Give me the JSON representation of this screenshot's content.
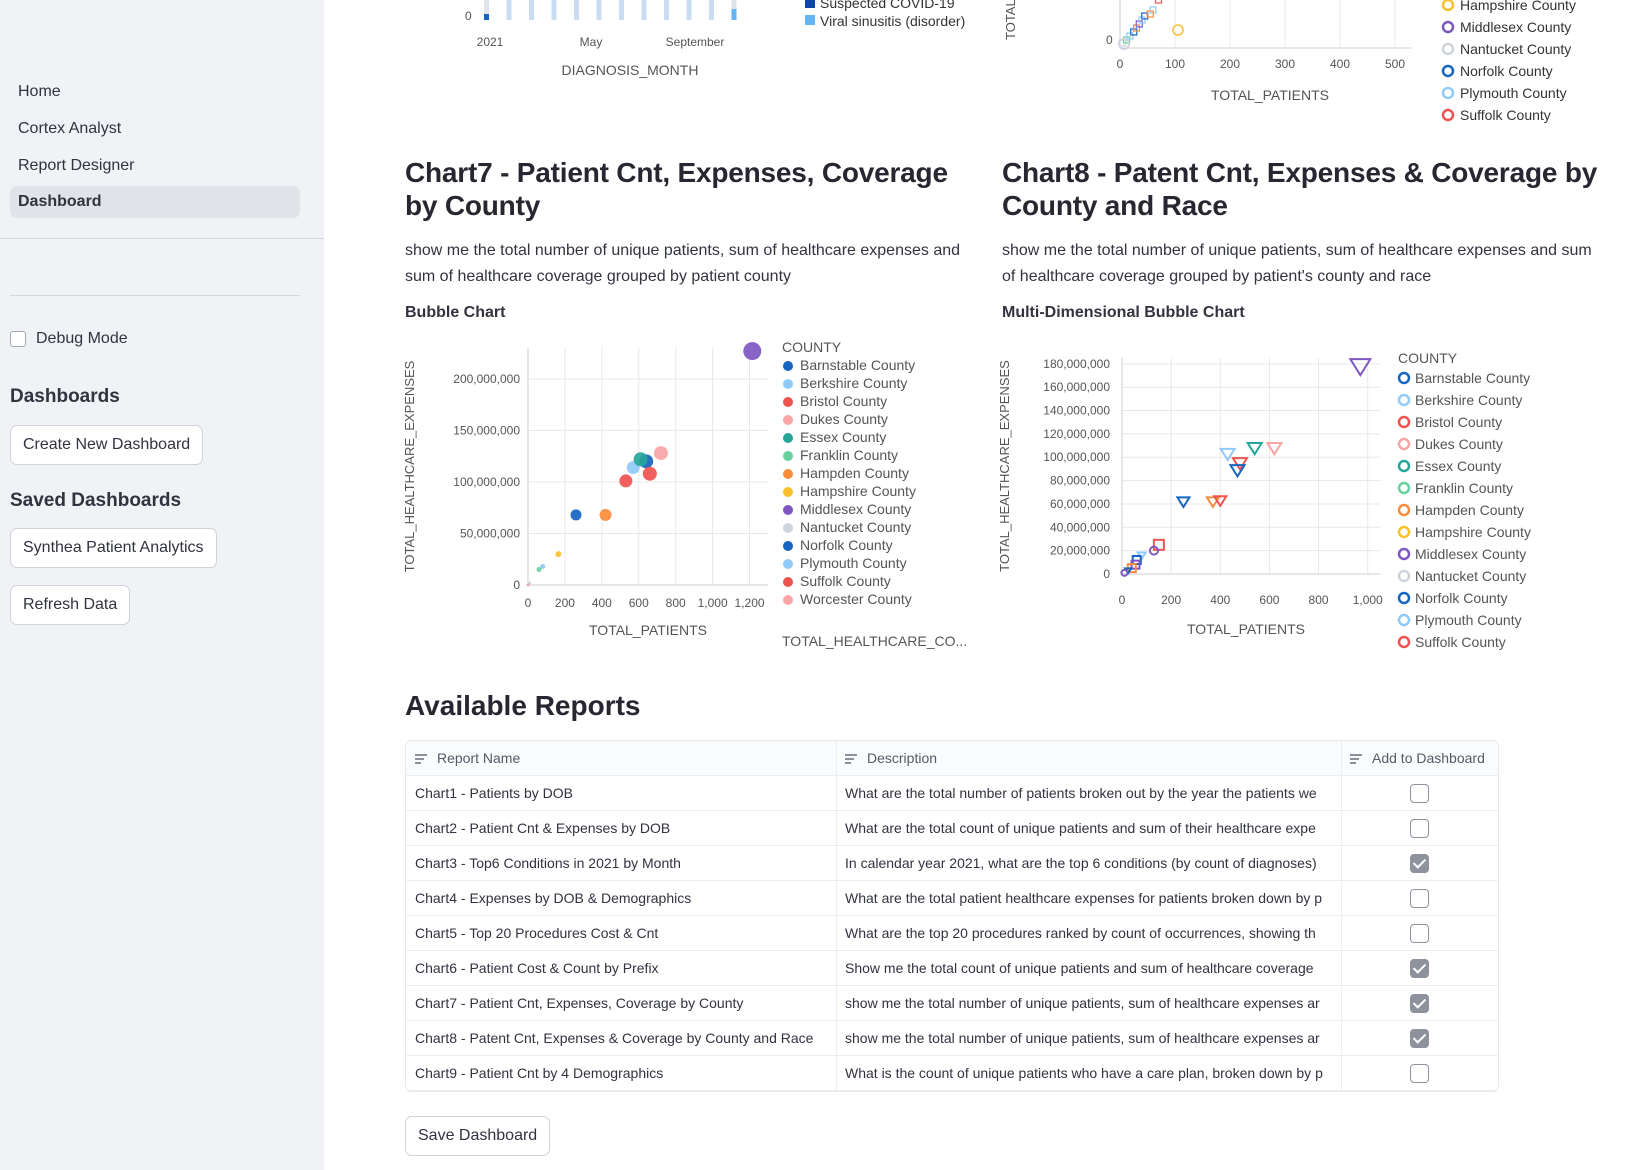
{
  "sidebar": {
    "nav": [
      "Home",
      "Cortex Analyst",
      "Report Designer",
      "Dashboard"
    ],
    "active_nav": "Dashboard",
    "debug_label": "Debug Mode",
    "dashboards_heading": "Dashboards",
    "create_button": "Create New Dashboard",
    "saved_heading": "Saved Dashboards",
    "saved_button": "Synthea Patient Analytics",
    "refresh_button": "Refresh Data"
  },
  "top_partial_left": {
    "y_tick": "0",
    "x_ticks": [
      "2021",
      "May",
      "September"
    ],
    "xlabel": "DIAGNOSIS_MONTH",
    "legend": [
      {
        "name": "Suspected COVID-19",
        "color": "#0d47a1"
      },
      {
        "name": "Viral sinusitis (disorder)",
        "color": "#64b5f6"
      }
    ],
    "bars": [
      0.3,
      1,
      1,
      1,
      1,
      1,
      1,
      1,
      1,
      1,
      1,
      0.55
    ]
  },
  "top_partial_right": {
    "ylabel": "TOTAL",
    "y_tick": "0",
    "x_ticks": [
      "0",
      "100",
      "200",
      "300",
      "400",
      "500"
    ],
    "xlabel": "TOTAL_PATIENTS",
    "legend": [
      {
        "name": "Hampshire County",
        "color": "#fbc02d"
      },
      {
        "name": "Middlesex County",
        "color": "#7e57c2"
      },
      {
        "name": "Nantucket County",
        "color": "#cfd4dc"
      },
      {
        "name": "Norfolk County",
        "color": "#1565c0"
      },
      {
        "name": "Plymouth County",
        "color": "#90caf9"
      },
      {
        "name": "Suffolk County",
        "color": "#ef5350"
      }
    ]
  },
  "chart7": {
    "title": "Chart7 - Patient Cnt, Expenses, Coverage by County",
    "description": "show me the total number of unique patients, sum of healthcare expenses and sum of healthcare coverage grouped by patient county",
    "subtitle": "Bubble Chart",
    "chart_data": {
      "type": "scatter",
      "xlabel": "TOTAL_PATIENTS",
      "ylabel": "TOTAL_HEALTHCARE_EXPENSES",
      "size_label": "TOTAL_HEALTHCARE_CO...",
      "xlim": [
        0,
        1300
      ],
      "ylim": [
        0,
        230000000
      ],
      "x_ticks": [
        0,
        200,
        400,
        600,
        800,
        1000,
        1200
      ],
      "x_tick_labels": [
        "0",
        "200",
        "400",
        "600",
        "800",
        "1,000",
        "1,200"
      ],
      "y_ticks": [
        0,
        50000000,
        100000000,
        150000000,
        200000000
      ],
      "y_tick_labels": [
        "0",
        "50,000,000",
        "100,000,000",
        "150,000,000",
        "200,000,000"
      ],
      "legend_title": "COUNTY",
      "series": [
        {
          "name": "Barnstable County",
          "color": "#1565c0",
          "x": 640,
          "y": 120000000,
          "r": 7
        },
        {
          "name": "Berkshire County",
          "color": "#90caf9",
          "x": 570,
          "y": 114000000,
          "r": 6.5
        },
        {
          "name": "Bristol County",
          "color": "#ef5350",
          "x": 530,
          "y": 101000000,
          "r": 6.5
        },
        {
          "name": "Dukes County",
          "color": "#f8a5a5",
          "x": 720,
          "y": 128000000,
          "r": 7
        },
        {
          "name": "Essex County",
          "color": "#26a69a",
          "x": 610,
          "y": 122000000,
          "r": 7
        },
        {
          "name": "Franklin County",
          "color": "#66d19e",
          "x": 60,
          "y": 15000000,
          "r": 2.5
        },
        {
          "name": "Hampden County",
          "color": "#fb8c3c",
          "x": 420,
          "y": 68000000,
          "r": 6
        },
        {
          "name": "Hampshire County",
          "color": "#fbc02d",
          "x": 165,
          "y": 30000000,
          "r": 3
        },
        {
          "name": "Middlesex County",
          "color": "#7e57c2",
          "x": 1215,
          "y": 227000000,
          "r": 9
        },
        {
          "name": "Nantucket County",
          "color": "#cfd4dc",
          "x": 10,
          "y": 2000000,
          "r": 1.5
        },
        {
          "name": "Norfolk County",
          "color": "#1565c0",
          "x": 260,
          "y": 68000000,
          "r": 5.5
        },
        {
          "name": "Plymouth County",
          "color": "#90caf9",
          "x": 80,
          "y": 18000000,
          "r": 2.5
        },
        {
          "name": "Suffolk County",
          "color": "#ef5350",
          "x": 660,
          "y": 108000000,
          "r": 7
        },
        {
          "name": "Worcester County",
          "color": "#f8a5a5",
          "x": 0,
          "y": 0,
          "r": 1.5
        }
      ]
    }
  },
  "chart8": {
    "title": "Chart8 - Patent Cnt, Expenses & Coverage by County and Race",
    "description": "show me the total number of unique patients, sum of healthcare expenses and sum of healthcare coverage grouped by patient's county and race",
    "subtitle": "Multi-Dimensional Bubble Chart",
    "chart_data": {
      "type": "scatter",
      "xlabel": "TOTAL_PATIENTS",
      "ylabel": "TOTAL_HEALTHCARE_EXPENSES",
      "xlim": [
        0,
        1050
      ],
      "ylim": [
        0,
        185000000
      ],
      "x_ticks": [
        0,
        200,
        400,
        600,
        800,
        1000
      ],
      "x_tick_labels": [
        "0",
        "200",
        "400",
        "600",
        "800",
        "1,000"
      ],
      "y_ticks": [
        0,
        20000000,
        40000000,
        60000000,
        80000000,
        100000000,
        120000000,
        140000000,
        160000000,
        180000000
      ],
      "y_tick_labels": [
        "0",
        "20,000,000",
        "40,000,000",
        "60,000,000",
        "80,000,000",
        "100,000,000",
        "120,000,000",
        "140,000,000",
        "160,000,000",
        "180,000,000"
      ],
      "legend_title": "COUNTY",
      "legend": [
        {
          "name": "Barnstable County",
          "color": "#1565c0"
        },
        {
          "name": "Berkshire County",
          "color": "#90caf9"
        },
        {
          "name": "Bristol County",
          "color": "#ef5350"
        },
        {
          "name": "Dukes County",
          "color": "#f8a5a5"
        },
        {
          "name": "Essex County",
          "color": "#26a69a"
        },
        {
          "name": "Franklin County",
          "color": "#66d19e"
        },
        {
          "name": "Hampden County",
          "color": "#fb8c3c"
        },
        {
          "name": "Hampshire County",
          "color": "#fbc02d"
        },
        {
          "name": "Middlesex County",
          "color": "#7e57c2"
        },
        {
          "name": "Nantucket County",
          "color": "#cfd4dc"
        },
        {
          "name": "Norfolk County",
          "color": "#1565c0"
        },
        {
          "name": "Plymouth County",
          "color": "#90caf9"
        },
        {
          "name": "Suffolk County",
          "color": "#ef5350"
        }
      ],
      "points": [
        {
          "x": 970,
          "y": 178000000,
          "color": "#7e57c2",
          "shape": "triangle",
          "s": 10
        },
        {
          "x": 540,
          "y": 108000000,
          "color": "#26a69a",
          "shape": "triangle",
          "s": 7
        },
        {
          "x": 620,
          "y": 108000000,
          "color": "#f8a5a5",
          "shape": "triangle",
          "s": 7
        },
        {
          "x": 430,
          "y": 103000000,
          "color": "#90caf9",
          "shape": "triangle",
          "s": 7
        },
        {
          "x": 480,
          "y": 95000000,
          "color": "#ef5350",
          "shape": "triangle",
          "s": 7
        },
        {
          "x": 470,
          "y": 89000000,
          "color": "#1565c0",
          "shape": "triangle",
          "s": 7
        },
        {
          "x": 250,
          "y": 62000000,
          "color": "#1565c0",
          "shape": "triangle",
          "s": 6
        },
        {
          "x": 370,
          "y": 62000000,
          "color": "#fb8c3c",
          "shape": "triangle",
          "s": 6
        },
        {
          "x": 400,
          "y": 63000000,
          "color": "#ef5350",
          "shape": "triangle",
          "s": 6
        },
        {
          "x": 150,
          "y": 25000000,
          "color": "#ef5350",
          "shape": "square",
          "s": 5
        },
        {
          "x": 130,
          "y": 20000000,
          "color": "#7e57c2",
          "shape": "circle",
          "s": 4
        },
        {
          "x": 80,
          "y": 16000000,
          "color": "#90caf9",
          "shape": "triangle",
          "s": 4
        },
        {
          "x": 60,
          "y": 12000000,
          "color": "#1565c0",
          "shape": "square",
          "s": 4
        },
        {
          "x": 55,
          "y": 8000000,
          "color": "#7e57c2",
          "shape": "square",
          "s": 4
        },
        {
          "x": 40,
          "y": 5000000,
          "color": "#fb8c3c",
          "shape": "square",
          "s": 4
        },
        {
          "x": 25,
          "y": 3000000,
          "color": "#1565c0",
          "shape": "triangle",
          "s": 3
        },
        {
          "x": 10,
          "y": 1000000,
          "color": "#7e57c2",
          "shape": "circle",
          "s": 3
        }
      ]
    }
  },
  "reports": {
    "title": "Available Reports",
    "columns": [
      "Report Name",
      "Description",
      "Add to Dashboard"
    ],
    "rows": [
      {
        "name": "Chart1 - Patients by DOB",
        "desc": "What are the total number of patients broken out by the year the patients we",
        "checked": false
      },
      {
        "name": "Chart2 - Patient Cnt & Expenses by DOB",
        "desc": "What are the total count of unique patients and sum of their healthcare expe",
        "checked": false
      },
      {
        "name": "Chart3 - Top6 Conditions in 2021 by Month",
        "desc": "In calendar year 2021, what are the top 6 conditions (by count of diagnoses)",
        "checked": true
      },
      {
        "name": "Chart4 - Expenses by DOB & Demographics",
        "desc": "What are the total patient healthcare expenses for patients broken down by p",
        "checked": false
      },
      {
        "name": "Chart5 - Top 20 Procedures Cost & Cnt",
        "desc": "What are the top 20 procedures ranked by count of occurrences, showing th",
        "checked": false
      },
      {
        "name": "Chart6 - Patient Cost & Count by Prefix",
        "desc": "Show me the total count of unique patients and sum of healthcare coverage",
        "checked": true
      },
      {
        "name": "Chart7 - Patient Cnt, Expenses, Coverage by County",
        "desc": "show me the total number of unique patients, sum of healthcare expenses ar",
        "checked": true
      },
      {
        "name": "Chart8 - Patent Cnt, Expenses & Coverage by County and Race",
        "desc": "show me the total number of unique patients, sum of healthcare expenses ar",
        "checked": true
      },
      {
        "name": "Chart9 - Patient Cnt by 4 Demographics",
        "desc": "What is the count of unique patients who have a care plan, broken down by p",
        "checked": false
      }
    ],
    "save_button": "Save Dashboard"
  }
}
